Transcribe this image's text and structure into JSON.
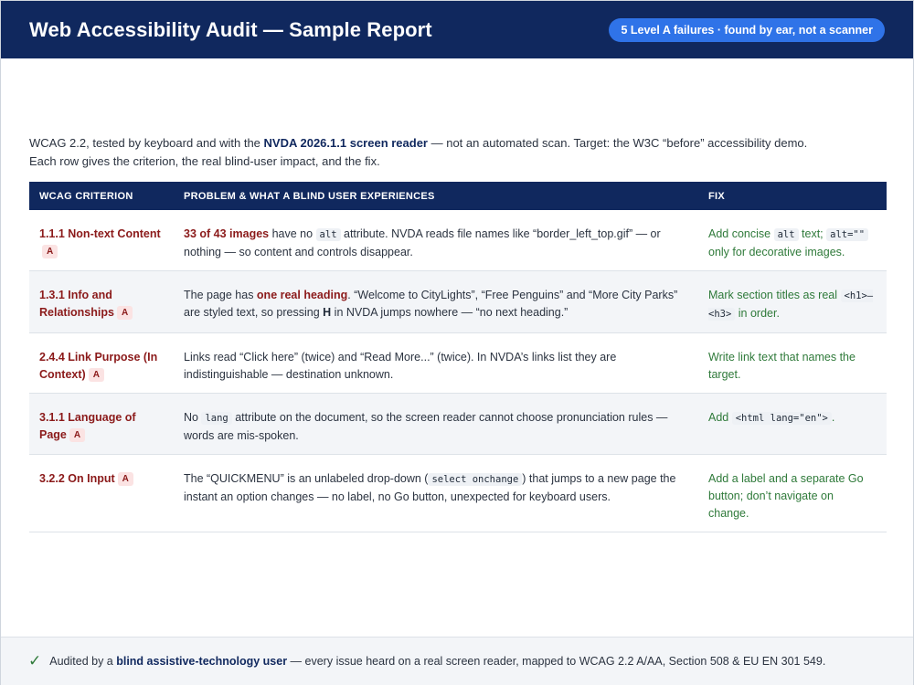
{
  "header": {
    "title": "Web Accessibility Audit — Sample Report",
    "pill": "5 Level A failures · found by ear, not a scanner"
  },
  "intro": {
    "p1": "WCAG 2.2, tested by keyboard and with the ",
    "p1_strong": "NVDA 2026.1.1 screen reader",
    "p1_rest": " — not an automated scan. Target: the W3C “before” accessibility demo.",
    "p2": "Each row gives the criterion, the real blind-user impact, and the fix."
  },
  "table": {
    "headers": [
      "WCAG criterion",
      "Problem & what a blind user experiences",
      "Fix"
    ],
    "badge": "A",
    "rows": [
      {
        "criterion": "1.1.1 Non-text Content",
        "p_strong": "33 of 43 images",
        "p_a": " have no ",
        "p_code": "alt",
        "p_b": " attribute. NVDA reads file names like “border_left_top.gif” — or nothing — so content and controls disappear.",
        "f_a": "Add concise ",
        "f_code1": "alt",
        "f_b": " text; ",
        "f_code2": "alt=\"\"",
        "f_c": " only for decorative images."
      },
      {
        "criterion": "1.3.1 Info and Relationships",
        "p_a": "The page has ",
        "p_strong": "one real heading",
        "p_b": ". “Welcome to CityLights”, “Free Penguins” and “More City Parks” are styled text, so pressing ",
        "p_key": "H",
        "p_c": " in NVDA jumps nowhere — “no next heading.”",
        "f_a": "Mark section titles as real ",
        "f_code1": "<h1>–<h3>",
        "f_b": " in order."
      },
      {
        "criterion": "2.4.4 Link Purpose (In Context)",
        "p_a": "Links read “Click here” (twice) and “Read More...” (twice). In NVDA’s links list they are indistinguishable — destination unknown.",
        "f_a": "Write link text that names the target."
      },
      {
        "criterion": "3.1.1 Language of Page",
        "p_a": "No ",
        "p_code": "lang",
        "p_b": " attribute on the document, so the screen reader cannot choose pronunciation rules — words are mis-spoken.",
        "f_a": "Add ",
        "f_code1": "<html lang=\"en\">",
        "f_b": "."
      },
      {
        "criterion": "3.2.2 On Input",
        "p_a": "The “QUICKMENU” is an unlabeled drop-down (",
        "p_code": "select onchange",
        "p_b": ") that jumps to a new page the instant an option changes — no label, no Go button, unexpected for keyboard users.",
        "f_a": "Add a label and a separate Go button; don’t navigate on change."
      }
    ]
  },
  "footer": {
    "a": "Audited by a ",
    "strong": "blind assistive-technology user",
    "b": " — every issue heard on a real screen reader, mapped to WCAG 2.2 A/AA, Section 508 & EU EN 301 549."
  }
}
